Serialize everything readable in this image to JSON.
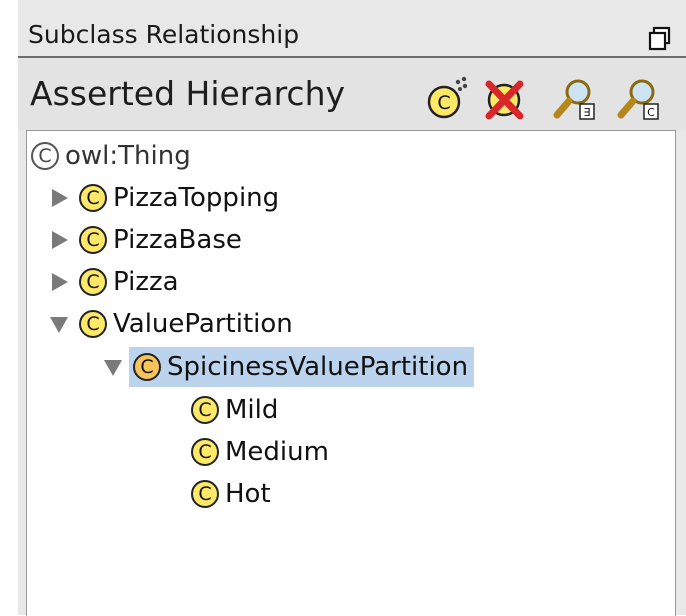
{
  "panel": {
    "title": "Subclass Relationship",
    "header": "Asserted Hierarchy",
    "toolbar": [
      {
        "name": "create-subclass-icon",
        "tooltip": ""
      },
      {
        "name": "delete-class-icon",
        "tooltip": ""
      },
      {
        "name": "find-property-icon",
        "tooltip": ""
      },
      {
        "name": "find-class-icon",
        "tooltip": ""
      }
    ]
  },
  "tree": {
    "root": {
      "badge": "C",
      "label": "owl:Thing"
    },
    "items": [
      {
        "badge": "C",
        "label": "PizzaTopping",
        "expanded": false
      },
      {
        "badge": "C",
        "label": "PizzaBase",
        "expanded": false
      },
      {
        "badge": "C",
        "label": "Pizza",
        "expanded": false
      },
      {
        "badge": "C",
        "label": "ValuePartition",
        "expanded": true
      },
      {
        "badge": "C",
        "label": "SpicinessValuePartition",
        "expanded": true,
        "selected": true
      },
      {
        "badge": "C",
        "label": "Mild"
      },
      {
        "badge": "C",
        "label": "Medium"
      },
      {
        "badge": "C",
        "label": "Hot"
      }
    ]
  },
  "colors": {
    "selection": "#bcd3ee",
    "class_badge": "#fde867",
    "selected_badge": "#f6c45a"
  }
}
